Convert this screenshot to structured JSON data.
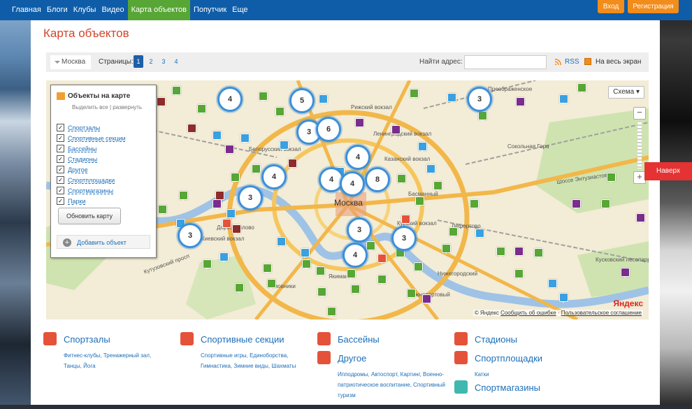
{
  "nav": {
    "items": [
      "Главная",
      "Блоги",
      "Клубы",
      "Видео",
      "Карта объектов",
      "Попутчик",
      "Еще"
    ],
    "active_index": 4,
    "login_label": "Вход",
    "register_label": "Регистрация"
  },
  "page": {
    "title": "Карта объектов"
  },
  "toolbar": {
    "city": "Москва",
    "pages_label": "Страницы:",
    "pages": [
      "1",
      "2",
      "3",
      "4"
    ],
    "current_page": "1",
    "find_label": "Найти адрес:",
    "find_value": "",
    "rss_label": "RSS",
    "fullscreen_label": "На весь экран"
  },
  "map": {
    "scheme_label": "Схема",
    "center_label": "Москва",
    "clusters": [
      "4",
      "5",
      "3",
      "6",
      "3",
      "4",
      "4",
      "4",
      "8",
      "4",
      "3",
      "3",
      "3",
      "4",
      "3"
    ],
    "place_labels": [
      "Кутузовский просп",
      "Хамовники",
      "Якиманка",
      "Лефортово",
      "Сокольная Гора",
      "Нижегородский",
      "Южнопортовый",
      "Басманный",
      "Белорусский вокзал",
      "Ленинградский вокзал",
      "Казанский вокзал",
      "Курский вокзал",
      "Киевский вокзал",
      "Дорогомилово",
      "Преображенское",
      "Рижский вокзал",
      "Шоссе Энтузиастов",
      "Кусковский лесопарк"
    ],
    "copyright_label": "© Яндекс",
    "report_error_label": "Сообщить об ошибке",
    "agreement_label": "Пользовательское соглашение",
    "yandex_logo": "Яндекс",
    "back_to_top_label": "Наверх"
  },
  "layers_panel": {
    "title": "Объекты на карте",
    "select_all_label": "Выделить все",
    "expand_label": "развернуть",
    "items": [
      {
        "label": "Спортзалы",
        "checked": true
      },
      {
        "label": "Спортивные секции",
        "checked": true
      },
      {
        "label": "Бассейны",
        "checked": true
      },
      {
        "label": "Стадионы",
        "checked": true
      },
      {
        "label": "Другое",
        "checked": true
      },
      {
        "label": "Спортплощадки",
        "checked": true
      },
      {
        "label": "Спортмагазины",
        "checked": true
      },
      {
        "label": "Парки",
        "checked": true
      }
    ],
    "update_button": "Обновить карту",
    "add_button": "Добавить объект"
  },
  "categories": [
    {
      "title": "Спортзалы",
      "desc": "Фитнес-клубы, Тренажерный зал, Танцы, Йога",
      "color": "#e5523a",
      "icon": "gym-icon"
    },
    {
      "title": "Спортивные секции",
      "desc": "Спортивные игры, Единоборства, Гимнастика, Зимние виды, Шахматы",
      "color": "#e5523a",
      "icon": "running-icon"
    },
    {
      "title": "Бассейны",
      "desc": "",
      "color": "#e5523a",
      "icon": "pool-icon"
    },
    {
      "title": "Другое",
      "desc": "Ипподромы, Автоспорт, Картинг, Военно-патриотическое воспитание, Спортивный туризм",
      "color": "#e5523a",
      "icon": "horse-icon"
    },
    {
      "title": "Стадионы",
      "desc": "",
      "color": "#e5523a",
      "icon": "stadium-icon"
    },
    {
      "title": "Спортплощадки",
      "desc": "Катки",
      "color": "#e5523a",
      "icon": "playground-icon"
    },
    {
      "title": "Спортмагазины",
      "desc": "",
      "color": "#3fb8b0",
      "icon": "shop-icon"
    }
  ],
  "colors": {
    "nav_bg": "#0f5da8",
    "nav_active": "#58a635",
    "accent_orange": "#f28c1a",
    "title_red": "#d2452a",
    "link_blue": "#1d6fb8",
    "cluster_blue": "#3d8fd8"
  }
}
